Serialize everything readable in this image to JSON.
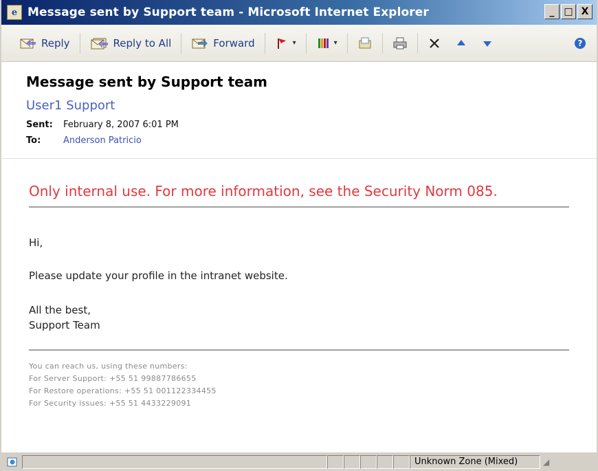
{
  "window": {
    "title": "Message sent by Support team - Microsoft Internet Explorer",
    "controls": [
      "_",
      "□",
      "X"
    ]
  },
  "toolbar": {
    "reply_label": "Reply",
    "reply_all_label": "Reply to All",
    "forward_label": "Forward",
    "icons": [
      "reply-icon",
      "reply-all-icon",
      "forward-icon",
      "flag-icon",
      "categories-icon",
      "move-to-folder-icon",
      "print-icon",
      "delete-icon",
      "previous-item-icon",
      "next-item-icon",
      "help-icon"
    ]
  },
  "message": {
    "subject": "Message sent by Support team",
    "sender": "User1 Support",
    "sent_label": "Sent:",
    "sent_value": "February 8, 2007 6:01 PM",
    "to_label": "To:",
    "to_value": "Anderson Patricio"
  },
  "body": {
    "banner": "Only internal use. For more information, see the Security Norm 085.",
    "greeting": "Hi,",
    "line": "Please update your profile in the intranet website.",
    "closing": "All the best,",
    "signature": "Support Team",
    "footer": [
      "You can reach us, using these numbers:",
      "For Server Support: +55 51 99887786655",
      "For Restore operations: +55 51 001122334455",
      "For Security issues: +55 51 4433229091"
    ]
  },
  "statusbar": {
    "zone": "Unknown Zone (Mixed)"
  },
  "colors": {
    "banner": "#e0393e",
    "link": "#4a5fc1",
    "titlebar": "#0a246a"
  }
}
